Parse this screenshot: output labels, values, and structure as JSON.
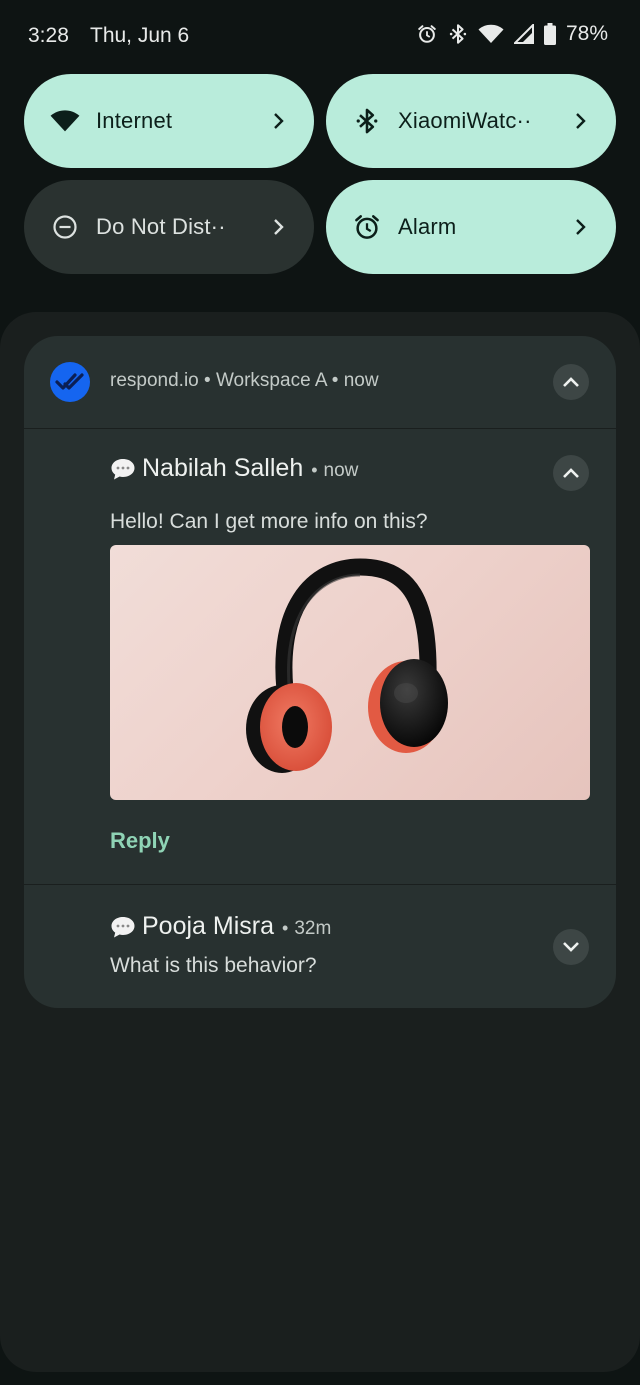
{
  "status_bar": {
    "time": "3:28",
    "date": "Thu, Jun 6",
    "battery": "78%",
    "icons": [
      "alarm-icon",
      "bluetooth-icon",
      "wifi-icon",
      "signal-icon",
      "battery-icon"
    ]
  },
  "quick_tiles": [
    {
      "label": "Internet",
      "state": "on",
      "icon": "wifi-icon"
    },
    {
      "label": "XiaomiWatc··",
      "state": "on",
      "icon": "bluetooth-icon"
    },
    {
      "label": "Do Not Dist··",
      "state": "off",
      "icon": "do-not-disturb-icon"
    },
    {
      "label": "Alarm",
      "state": "on",
      "icon": "alarm-icon"
    }
  ],
  "notification": {
    "app": "respond.io",
    "workspace": "Workspace A",
    "time": "now",
    "messages": [
      {
        "sender": "Nabilah Salleh",
        "time": "now",
        "text": "Hello! Can I get more info on this?",
        "attachment": "headphones image",
        "action": "Reply",
        "expanded": true
      },
      {
        "sender": "Pooja Misra",
        "time": "32m",
        "text": "What is this behavior?",
        "expanded": false
      }
    ]
  },
  "colors": {
    "background": "#0e1413",
    "shade": "#1a1f1e",
    "card": "#283130",
    "tile_on": "#b9ecdb",
    "tile_off": "#2a3230",
    "app_icon": "#1565f0",
    "reply_accent": "#8fd3b5"
  }
}
